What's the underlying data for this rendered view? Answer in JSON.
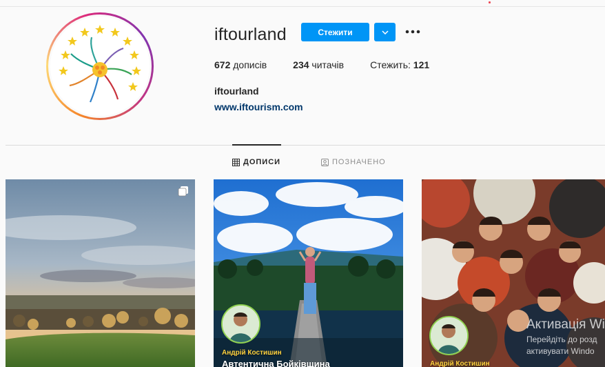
{
  "profile": {
    "username": "iftourland",
    "follow_label": "Стежити",
    "posts_count": "672",
    "posts_label": "дописів",
    "followers_count": "234",
    "followers_label": "читачів",
    "following_label": "Стежить:",
    "following_count": "121",
    "full_name": "iftourland",
    "website": "www.iftourism.com"
  },
  "tabs": [
    {
      "label": "ДОПИСИ",
      "icon": "grid-icon",
      "active": true
    },
    {
      "label": "ПОЗНАЧЕНО",
      "icon": "tagged-icon",
      "active": false
    }
  ],
  "posts": [
    {
      "kind": "landscape-photo",
      "multi": true
    },
    {
      "kind": "video",
      "creator": "Андрій Костишин",
      "caption": "Автентична Бойківщина"
    },
    {
      "kind": "group-photo",
      "creator": "Андрій Костишин"
    }
  ],
  "watermark": {
    "title": "Активація Wi",
    "line1": "Перейдіть до розд",
    "line2": "активувати Windo"
  },
  "colors": {
    "accent": "#0095f6",
    "link": "#00376b",
    "creator_name": "#ffd23f"
  }
}
